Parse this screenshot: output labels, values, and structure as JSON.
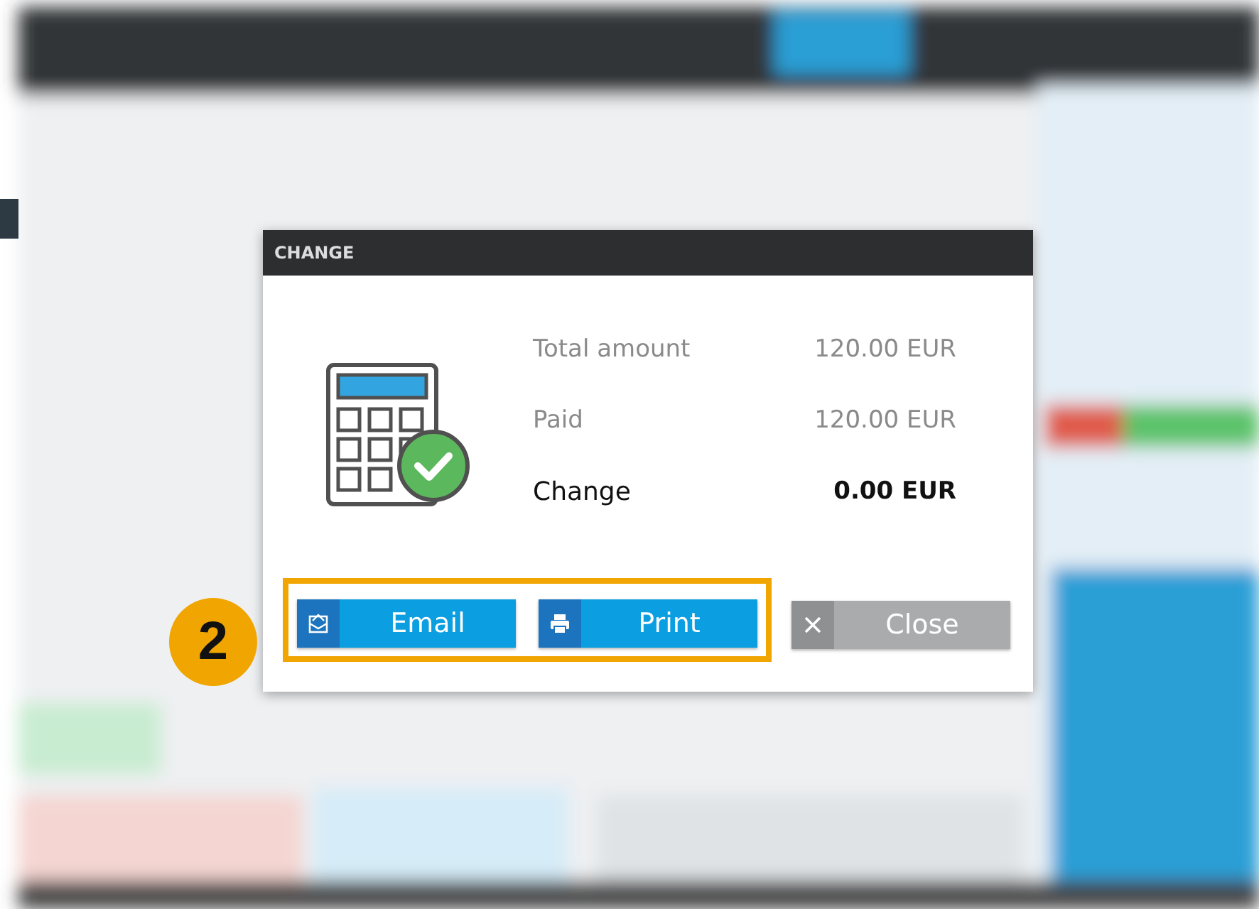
{
  "dialog": {
    "title": "CHANGE",
    "rows": [
      {
        "label": "Total amount",
        "value": "120.00 EUR",
        "kind": "line"
      },
      {
        "label": "Paid",
        "value": "120.00 EUR",
        "kind": "line"
      },
      {
        "label": "Change",
        "value": "0.00 EUR",
        "kind": "result"
      }
    ],
    "buttons": [
      {
        "label": "Email",
        "kind": "email",
        "highlighted": true
      },
      {
        "label": "Print",
        "kind": "print",
        "highlighted": true
      },
      {
        "label": "Close",
        "kind": "close",
        "highlighted": false
      }
    ]
  },
  "callout": {
    "step": "2"
  }
}
